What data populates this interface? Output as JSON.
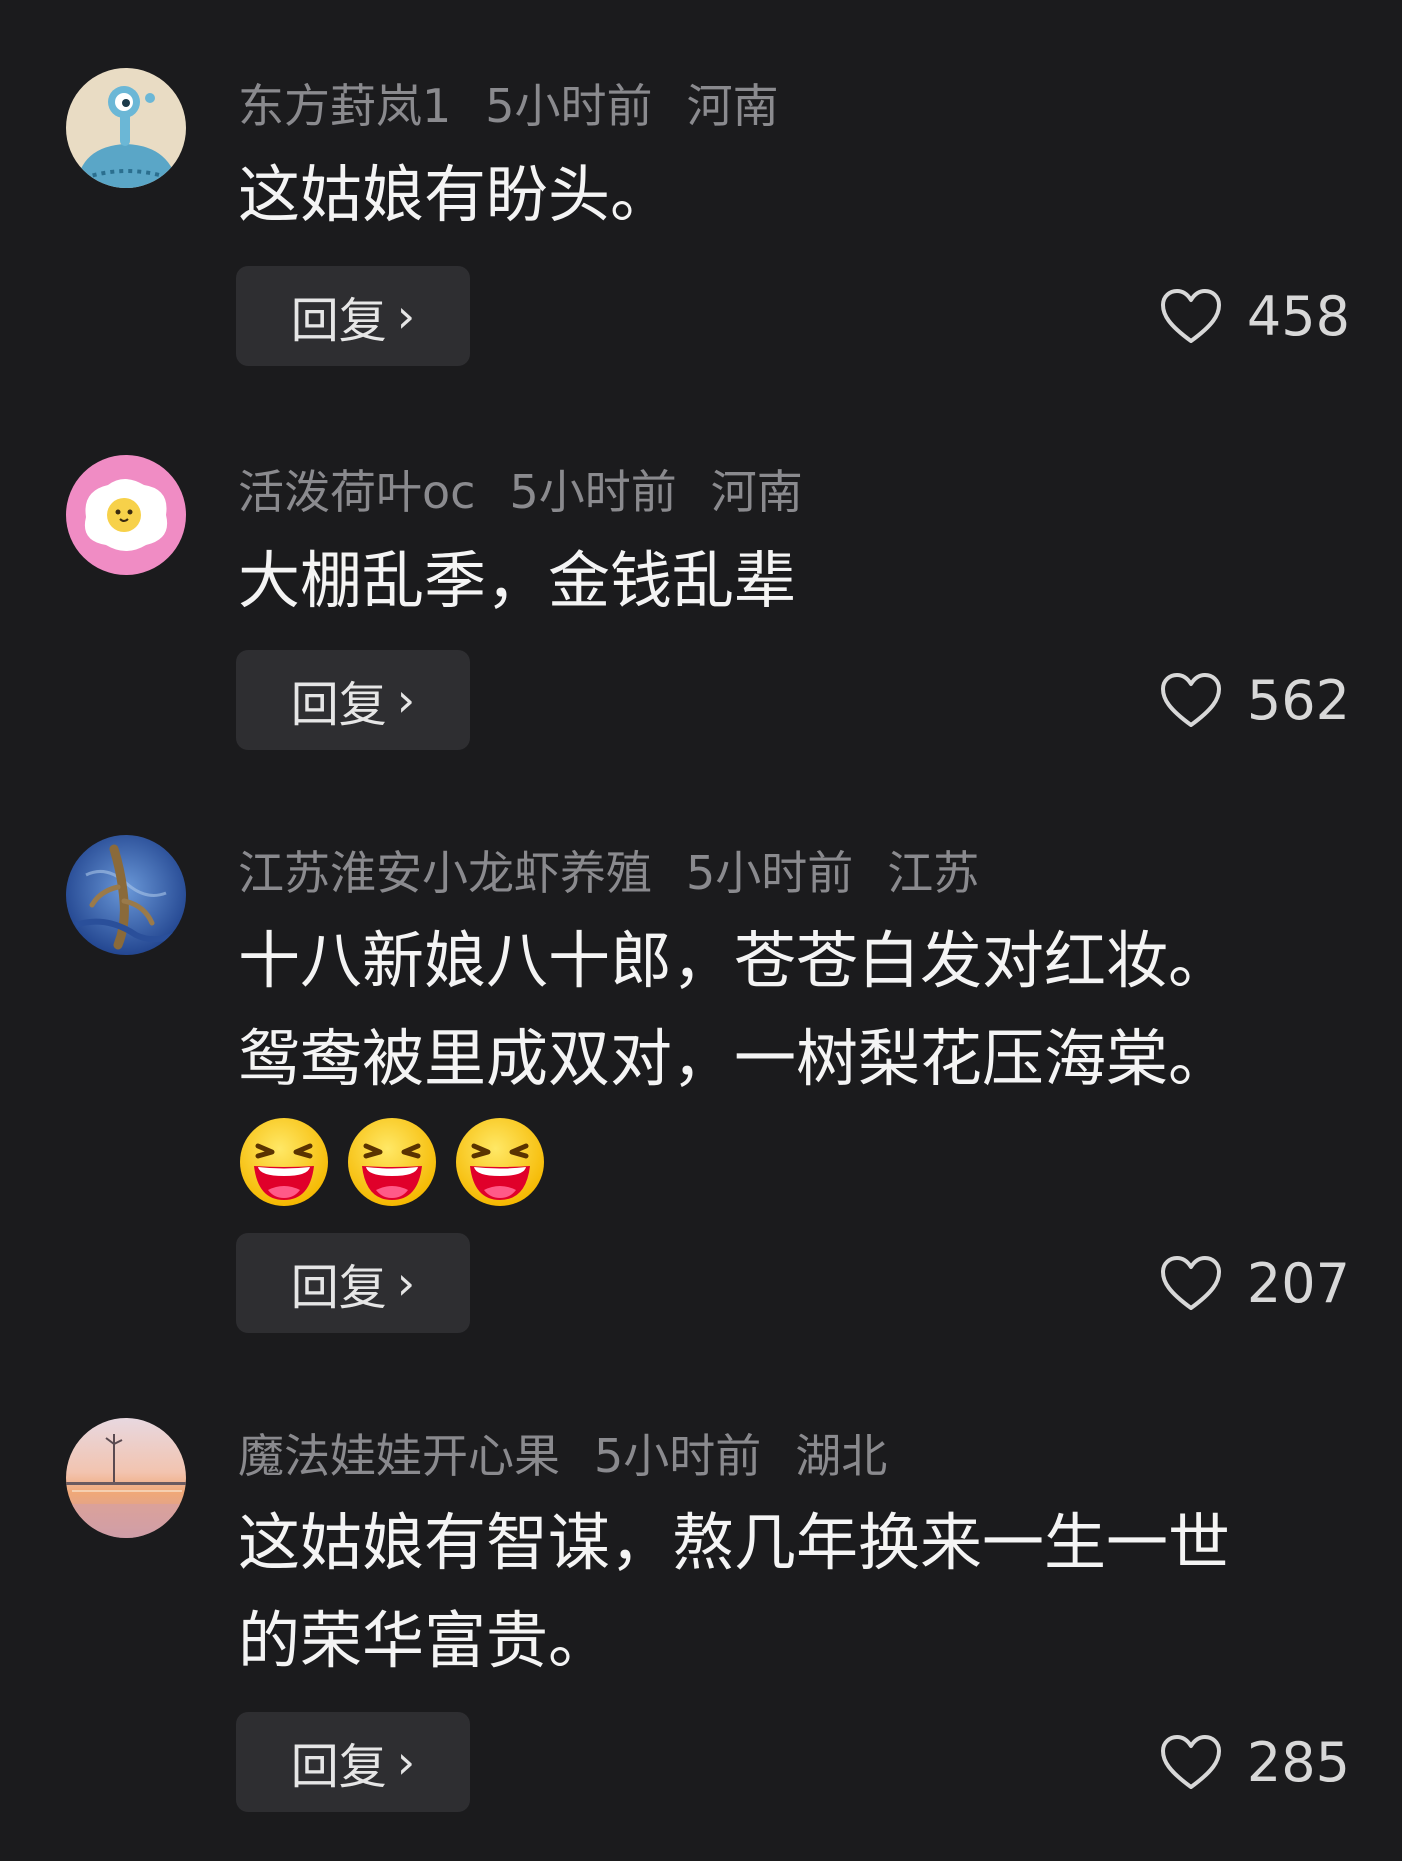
{
  "comments": [
    {
      "username": "东方葑岚1",
      "time": "5小时前",
      "location": "河南",
      "text": "这姑娘有盼头。",
      "reply_label": "回复",
      "likes": "458",
      "avatar_icon": "alien-cartoon-avatar"
    },
    {
      "username": "活泼荷叶oc",
      "time": "5小时前",
      "location": "河南",
      "text": "大棚乱季，金钱乱辈",
      "reply_label": "回复",
      "likes": "562",
      "avatar_icon": "fried-egg-avatar"
    },
    {
      "username": "江苏淮安小龙虾养殖",
      "time": "5小时前",
      "location": "江苏",
      "text_lines": [
        "十八新娘八十郎，苍苍白发对红妆。",
        "鸳鸯被里成双对，一树梨花压海棠。"
      ],
      "emojis": [
        "laughing-emoji",
        "laughing-emoji",
        "laughing-emoji"
      ],
      "reply_label": "回复",
      "likes": "207",
      "avatar_icon": "crayfish-photo-avatar"
    },
    {
      "username": "魔法娃娃开心果",
      "time": "5小时前",
      "location": "湖北",
      "text_lines": [
        "这姑娘有智谋，熬几年换来一生一世",
        "的荣华富贵。"
      ],
      "reply_label": "回复",
      "likes": "285",
      "avatar_icon": "sunset-photo-avatar"
    }
  ],
  "colors": {
    "background": "#1b1b1d",
    "meta_text": "#8a8a8e",
    "body_text": "#f4f4f4",
    "reply_button_bg": "#2e2e31"
  }
}
